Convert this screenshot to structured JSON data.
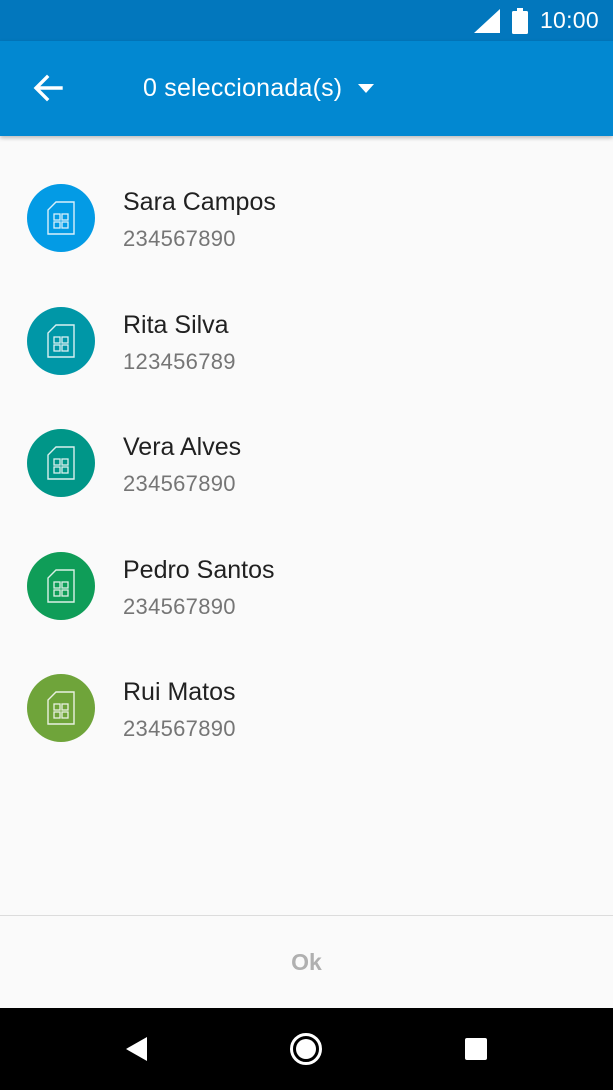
{
  "status_bar": {
    "time": "10:00",
    "icons": [
      "signal-icon",
      "battery-icon"
    ]
  },
  "app_bar": {
    "title": "0 seleccionada(s)",
    "back_icon": "arrow-left-icon",
    "dropdown_icon": "caret-down-icon",
    "background": "#0288d1"
  },
  "contacts": [
    {
      "name": "Sara Campos",
      "number": "234567890",
      "color": "#039be5",
      "icon": "sim-card-icon"
    },
    {
      "name": "Rita Silva",
      "number": "123456789",
      "color": "#0097a7",
      "icon": "sim-card-icon"
    },
    {
      "name": "Vera Alves",
      "number": "234567890",
      "color": "#009688",
      "icon": "sim-card-icon"
    },
    {
      "name": "Pedro Santos",
      "number": "234567890",
      "color": "#0f9d58",
      "icon": "sim-card-icon"
    },
    {
      "name": "Rui Matos",
      "number": "234567890",
      "color": "#6fa43a",
      "icon": "sim-card-icon"
    }
  ],
  "footer": {
    "ok_label": "Ok"
  },
  "nav_bar": {
    "icons": [
      "back-triangle-icon",
      "home-circle-icon",
      "recents-square-icon"
    ]
  }
}
